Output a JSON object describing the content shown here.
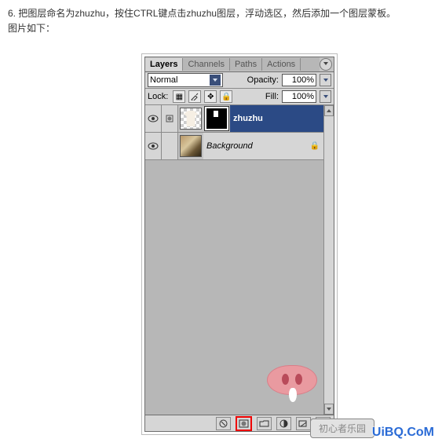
{
  "instructions": {
    "line1": "6. 把图层命名为zhuzhu，按住CTRL键点击zhuzhu图层，浮动选区，然后添加一个图层蒙板。",
    "line2": "图片如下："
  },
  "panel": {
    "tabs": [
      {
        "label": "Layers",
        "active": true
      },
      {
        "label": "Channels",
        "active": false
      },
      {
        "label": "Paths",
        "active": false
      },
      {
        "label": "Actions",
        "active": false
      }
    ],
    "blend_mode": "Normal",
    "opacity_label": "Opacity:",
    "opacity_value": "100%",
    "lock_label": "Lock:",
    "fill_label": "Fill:",
    "fill_value": "100%",
    "layers": [
      {
        "name": "zhuzhu",
        "italic": false,
        "selected": true,
        "has_mask": true,
        "thumb": "tshirt",
        "locked": false
      },
      {
        "name": "Background",
        "italic": true,
        "selected": false,
        "has_mask": false,
        "thumb": "photo",
        "locked": true
      }
    ]
  },
  "footer_button": "初心者乐园",
  "watermark": "UiBQ.CoM"
}
